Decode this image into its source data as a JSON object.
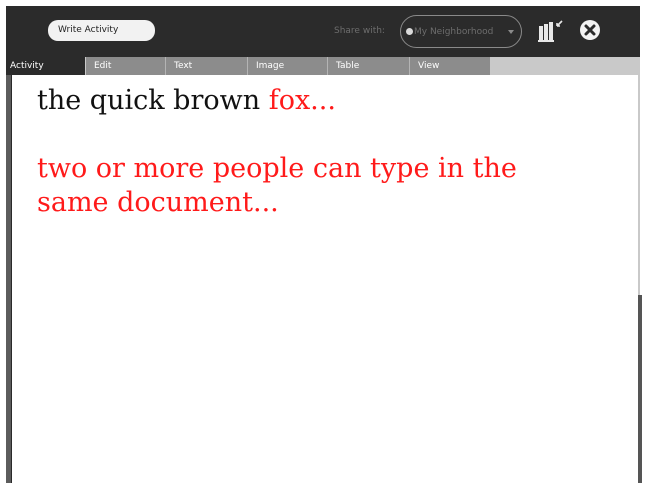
{
  "toolbar": {
    "activity_title": "Write Activity",
    "share_label": "Share with:",
    "share_value": "My Neighborhood",
    "keep_icon": "keep-icon",
    "stop_icon": "stop-icon"
  },
  "tabs": [
    {
      "label": "Activity",
      "active": true
    },
    {
      "label": "Edit",
      "active": false
    },
    {
      "label": "Text",
      "active": false
    },
    {
      "label": "Image",
      "active": false
    },
    {
      "label": "Table",
      "active": false
    },
    {
      "label": "View",
      "active": false
    }
  ],
  "document": {
    "line1_black": "the quick brown ",
    "line1_red": "fox...",
    "line2": "two or more people can type in the",
    "line3": "same document..."
  },
  "colors": {
    "toolbar_bg": "#2b2b2b",
    "tab_inactive_bg": "#8c8c8c",
    "tab_bar_bg": "#c9c9c9",
    "collaborator_text": "#ff1a1a",
    "local_text": "#111111"
  }
}
